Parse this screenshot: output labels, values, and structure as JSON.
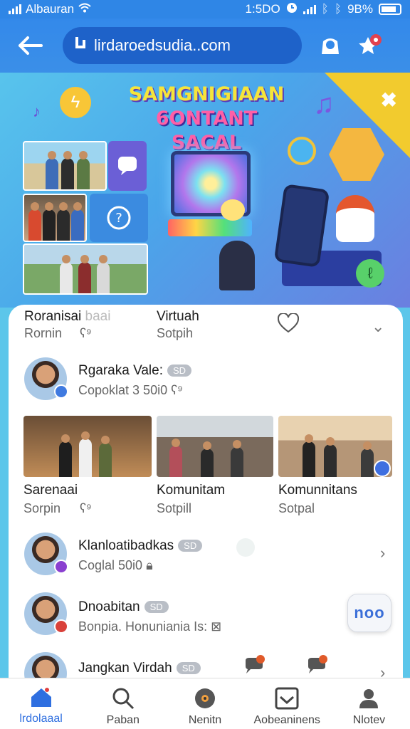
{
  "status": {
    "carrier": "Albauran",
    "time": "1:5DO",
    "battery": "9B%"
  },
  "nav": {
    "url": "lirdaroedsudia..com"
  },
  "banner": {
    "line1": "SAMGNIGIAAN",
    "line2": "6ONTANT SACAL"
  },
  "header_row": {
    "col1_title": "Roranisai",
    "col1_title_faded": "baai",
    "col1_sub": "Rornin",
    "col2_title": "Virtuah",
    "col2_sub": "Sotpih"
  },
  "featured": {
    "name": "Rgaraka Vale:",
    "badge": "SD",
    "sub": "Copoklat 3 50i0"
  },
  "thumbs": [
    {
      "title": "Sarenaai",
      "sub": "Sorpin"
    },
    {
      "title": "Komunitam",
      "sub": "Sotpill"
    },
    {
      "title": "Komunnitans",
      "sub": "Sotpal"
    }
  ],
  "list": [
    {
      "name": "Klanloatibadkas",
      "badge": "SD",
      "sub": "Coglal 50i0"
    },
    {
      "name": "Dnoabitan",
      "badge": "SD",
      "sub": "Bonpia. Honuniania Is:"
    },
    {
      "name": "Jangkan Virdah",
      "badge": "SD",
      "sub": ""
    }
  ],
  "more_label": "noo",
  "tabs": [
    {
      "label": "lrdolaaal",
      "icon": "home-icon"
    },
    {
      "label": "Paban",
      "icon": "search-icon"
    },
    {
      "label": "Nenitn",
      "icon": "disc-icon"
    },
    {
      "label": "Aobeaninens",
      "icon": "inbox-icon"
    },
    {
      "label": "Nlotev",
      "icon": "profile-icon"
    }
  ],
  "colors": {
    "accent": "#2f6fe0",
    "nav_bg": "#3389ea",
    "url_bg": "#1e62c9",
    "banner_bg": "#58c4ec"
  }
}
